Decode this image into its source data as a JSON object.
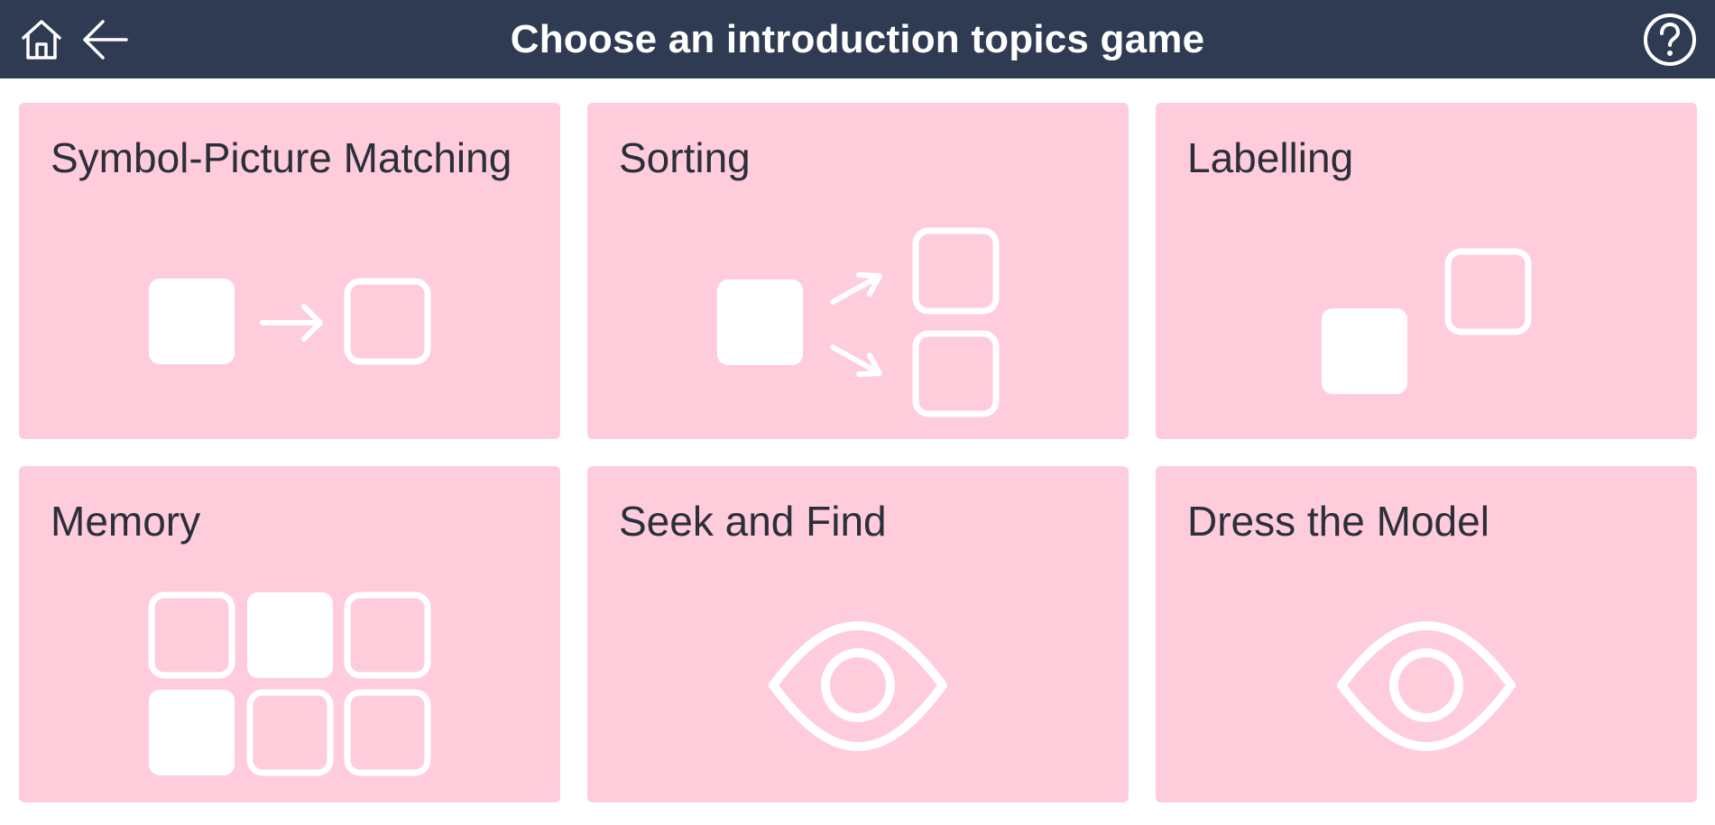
{
  "header": {
    "title": "Choose an introduction topics game",
    "home_icon": "home-icon",
    "back_icon": "back-arrow-icon",
    "help_icon": "help-icon"
  },
  "games": [
    {
      "label": "Symbol-Picture Matching",
      "icon": "matching-icon"
    },
    {
      "label": "Sorting",
      "icon": "sorting-icon"
    },
    {
      "label": "Labelling",
      "icon": "labelling-icon"
    },
    {
      "label": "Memory",
      "icon": "memory-grid-icon"
    },
    {
      "label": "Seek and Find",
      "icon": "eye-icon"
    },
    {
      "label": "Dress the Model",
      "icon": "eye-icon"
    }
  ],
  "colors": {
    "header_bg": "#2e3b52",
    "card_bg": "#ffccdc",
    "icon": "#ffffff",
    "card_text": "#2b2f3a"
  }
}
